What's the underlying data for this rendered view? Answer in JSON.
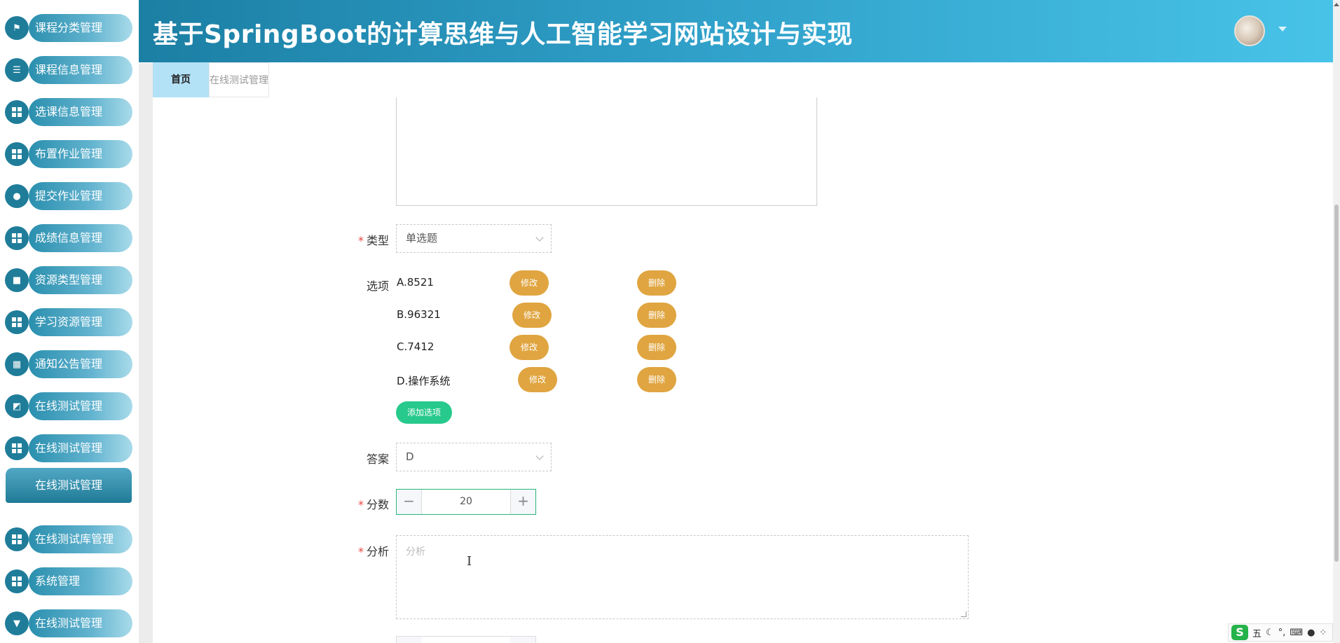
{
  "header": {
    "title": "基于SpringBoot的计算思维与人工智能学习网站设计与实现"
  },
  "sidebar": {
    "items": [
      {
        "label": "课程分类管理",
        "icon": "flag-icon"
      },
      {
        "label": "课程信息管理",
        "icon": "list-icon"
      },
      {
        "label": "选课信息管理",
        "icon": "grid-icon"
      },
      {
        "label": "布置作业管理",
        "icon": "grid-icon"
      },
      {
        "label": "提交作业管理",
        "icon": "user-icon"
      },
      {
        "label": "成绩信息管理",
        "icon": "grid-icon"
      },
      {
        "label": "资源类型管理",
        "icon": "briefcase-icon"
      },
      {
        "label": "学习资源管理",
        "icon": "grid-icon"
      },
      {
        "label": "通知公告管理",
        "icon": "table-icon"
      },
      {
        "label": "在线测试管理",
        "icon": "chart-icon"
      },
      {
        "label": "在线测试管理",
        "icon": "grid-icon"
      }
    ],
    "active_sub": "在线测试管理",
    "items_after": [
      {
        "label": "在线测试库管理",
        "icon": "grid-icon"
      },
      {
        "label": "系统管理",
        "icon": "grid-icon"
      },
      {
        "label": "在线测试管理",
        "icon": "pin-icon"
      }
    ]
  },
  "tabs": {
    "home": "首页",
    "current": "在线测试管理"
  },
  "form": {
    "type": {
      "label": "类型",
      "value": "单选题"
    },
    "options_label": "选项",
    "options": [
      {
        "text": "A.8521",
        "edit": "修改",
        "delete": "删除"
      },
      {
        "text": "B.96321",
        "edit": "修改",
        "delete": "删除"
      },
      {
        "text": "C.7412",
        "edit": "修改",
        "delete": "删除"
      },
      {
        "text": "D.操作系统",
        "edit": "修改",
        "delete": "删除"
      }
    ],
    "add_option": "添加选项",
    "answer": {
      "label": "答案",
      "value": "D"
    },
    "score": {
      "label": "分数",
      "value": "20",
      "minus": "−",
      "plus": "+"
    },
    "analysis": {
      "label": "分析",
      "placeholder": "分析"
    },
    "required_mark": "*"
  },
  "ime": {
    "logo": "S",
    "mode": "五",
    "icons": [
      "moon-icon",
      "punct-icon",
      "keyboard-icon",
      "user-icon",
      "grid-icon"
    ]
  },
  "colors": {
    "header_start": "#1c7fa4",
    "header_end": "#48c3e8",
    "edit_button": "#e0a540",
    "add_button": "#27c98c",
    "required": "#e8473f"
  }
}
